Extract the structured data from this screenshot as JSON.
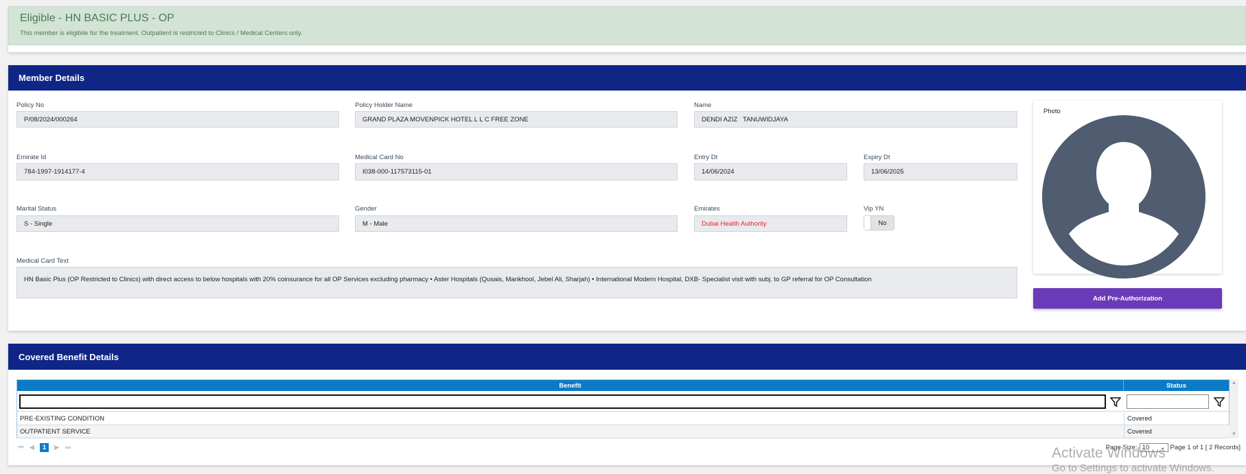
{
  "alert": {
    "title": "Eligible - HN BASIC PLUS - OP",
    "message": "This member is eligibile for the treatment. Outpatient is restricted to Clinics / Medical Centers only."
  },
  "member": {
    "header": "Member Details",
    "fields": {
      "policy_no": {
        "label": "Policy No",
        "value": "P/08/2024/000264"
      },
      "policy_holder": {
        "label": "Policy Holder Name",
        "value": "GRAND PLAZA MOVENPICK HOTEL L L C FREE ZONE"
      },
      "name": {
        "label": "Name",
        "value": "DENDI AZIZ   TANUWIDJAYA"
      },
      "emirate_id": {
        "label": "Emirate Id",
        "value": "784-1997-1914177-4"
      },
      "medical_card_no": {
        "label": "Medical Card No",
        "value": "I038-000-117573115-01"
      },
      "entry_dt": {
        "label": "Entry Dt",
        "value": "14/06/2024"
      },
      "expiry_dt": {
        "label": "Expiry Dt",
        "value": "13/06/2025"
      },
      "marital_status": {
        "label": "Marital Status",
        "value": "S - Single"
      },
      "gender": {
        "label": "Gender",
        "value": "M - Male"
      },
      "emirates": {
        "label": "Emirates",
        "value": "Dubai Health Authority"
      },
      "vip": {
        "label": "Vip YN",
        "value": "No"
      },
      "medical_card_text": {
        "label": "Medical Card Text",
        "value": "HN Basic Plus (OP Restricted to Clinics) with direct  access to below hospitals with 20% coinsurance for all OP Services excluding pharmacy • Aster Hospitals (Qusais, Mankhool, Jebel Ali,  Sharjah) • International Modern Hospital, DXB- Specialist visit with subj. to GP referral for OP Consultation"
      }
    },
    "photo_label": "Photo",
    "add_preauth": "Add Pre-Authorization"
  },
  "benefits": {
    "header": "Covered Benefit Details",
    "columns": [
      "Benefit",
      "Status"
    ],
    "rows": [
      {
        "benefit": "PRE-EXISTING CONDITION",
        "status": "Covered"
      },
      {
        "benefit": "OUTPATIENT SERVICE",
        "status": "Covered"
      }
    ],
    "pager": {
      "current": "1",
      "page_size_label": "Page Size:",
      "page_size": "10",
      "info": "Page 1 of 1 [ 2 Records]"
    }
  },
  "watermark": {
    "line1": "Activate Windows",
    "line2": "Go to Settings to activate Windows."
  },
  "colors": {
    "header": "#0f2687",
    "accent": "#6a3ab8",
    "table_header": "#0b7bc7",
    "alert": "#d3e3d6",
    "error": "#e8202a"
  }
}
